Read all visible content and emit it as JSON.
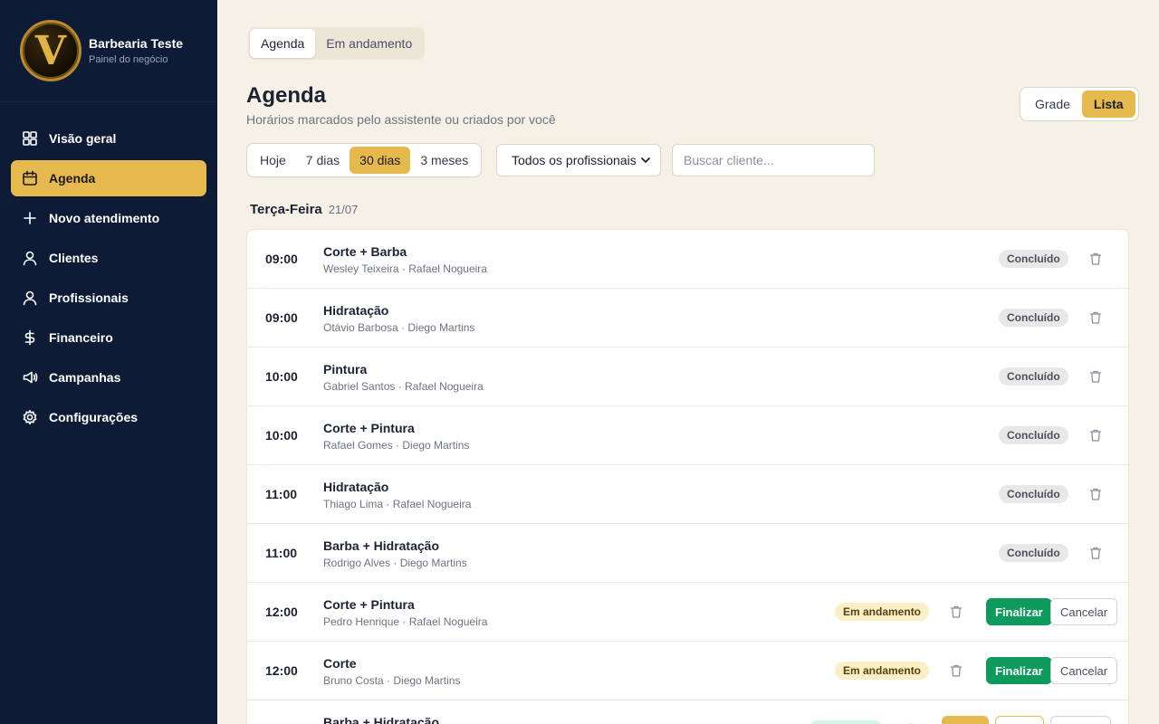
{
  "sidebar": {
    "brand": {
      "logo_letter": "V",
      "name": "Barbearia Teste",
      "subtitle": "Painel do negócio"
    },
    "items": [
      {
        "id": "visao-geral",
        "label": "Visão geral",
        "icon": "grid-icon",
        "active": false
      },
      {
        "id": "agenda",
        "label": "Agenda",
        "icon": "calendar-icon",
        "active": true
      },
      {
        "id": "novo-atendimento",
        "label": "Novo atendimento",
        "icon": "plus-icon",
        "active": false
      },
      {
        "id": "clientes",
        "label": "Clientes",
        "icon": "user-icon",
        "active": false
      },
      {
        "id": "profissionais",
        "label": "Profissionais",
        "icon": "user-icon",
        "active": false
      },
      {
        "id": "financeiro",
        "label": "Financeiro",
        "icon": "dollar-icon",
        "active": false
      },
      {
        "id": "campanhas",
        "label": "Campanhas",
        "icon": "megaphone-icon",
        "active": false
      },
      {
        "id": "configuracoes",
        "label": "Configurações",
        "icon": "gear-icon",
        "active": false
      }
    ]
  },
  "tabs": [
    {
      "label": "Agenda",
      "active": true
    },
    {
      "label": "Em andamento",
      "active": false
    }
  ],
  "page": {
    "title": "Agenda",
    "subtitle": "Horários marcados pelo assistente ou criados por você"
  },
  "view_toggle": [
    {
      "label": "Grade",
      "active": false
    },
    {
      "label": "Lista",
      "active": true
    }
  ],
  "filters": {
    "ranges": [
      {
        "label": "Hoje",
        "active": false
      },
      {
        "label": "7 dias",
        "active": false
      },
      {
        "label": "30 dias",
        "active": true
      },
      {
        "label": "3 meses",
        "active": false
      }
    ],
    "professional_select": "Todos os profissionais",
    "search_placeholder": "Buscar cliente..."
  },
  "day": {
    "name": "Terça-Feira",
    "date": "21/07"
  },
  "appointments": [
    {
      "time": "09:00",
      "service": "Corte + Barba",
      "client_pro": "Wesley Teixeira · Rafael Nogueira",
      "status": "Concluído",
      "kind": "done"
    },
    {
      "time": "09:00",
      "service": "Hidratação",
      "client_pro": "Otávio Barbosa · Diego Martins",
      "status": "Concluído",
      "kind": "done"
    },
    {
      "time": "10:00",
      "service": "Pintura",
      "client_pro": "Gabriel Santos · Rafael Nogueira",
      "status": "Concluído",
      "kind": "done"
    },
    {
      "time": "10:00",
      "service": "Corte + Pintura",
      "client_pro": "Rafael Gomes · Diego Martins",
      "status": "Concluído",
      "kind": "done"
    },
    {
      "time": "11:00",
      "service": "Hidratação",
      "client_pro": "Thiago Lima · Rafael Nogueira",
      "status": "Concluído",
      "kind": "done"
    },
    {
      "time": "11:00",
      "service": "Barba + Hidratação",
      "client_pro": "Rodrigo Alves · Diego Martins",
      "status": "Concluído",
      "kind": "done"
    },
    {
      "time": "12:00",
      "service": "Corte + Pintura",
      "client_pro": "Pedro Henrique · Rafael Nogueira",
      "status": "Em andamento",
      "kind": "progress"
    },
    {
      "time": "12:00",
      "service": "Corte",
      "client_pro": "Bruno Costa · Diego Martins",
      "status": "Em andamento",
      "kind": "progress"
    },
    {
      "time": "",
      "service": "Barba + Hidratação",
      "client_pro": "",
      "status": "",
      "kind": "other"
    }
  ],
  "actions": {
    "finalize": "Finalizar",
    "cancel": "Cancelar"
  },
  "colors": {
    "sidebar_bg": "#0d1b36",
    "accent_gold": "#e6b94f",
    "page_bg": "#f5f1e6",
    "finalize_green": "#0e9a5c"
  }
}
